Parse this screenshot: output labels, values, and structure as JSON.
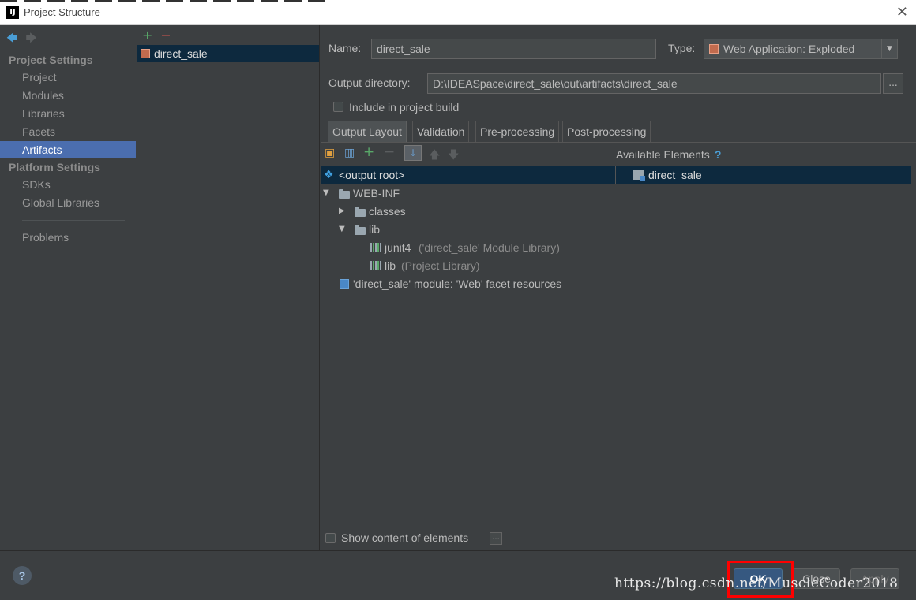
{
  "window": {
    "title": "Project Structure",
    "app_icon": "IJ",
    "close_glyph": "✕"
  },
  "nav": {
    "back_glyph": "🡄",
    "fwd_glyph": "🡆",
    "section_project": "Project Settings",
    "section_platform": "Platform Settings",
    "items": {
      "project": "Project",
      "modules": "Modules",
      "libraries": "Libraries",
      "facets": "Facets",
      "artifacts": "Artifacts",
      "sdks": "SDKs",
      "global_libraries": "Global Libraries",
      "problems": "Problems"
    },
    "selected": "Artifacts"
  },
  "artifacts": {
    "add_glyph": "+",
    "remove_glyph": "−",
    "items": [
      "direct_sale"
    ]
  },
  "details": {
    "name_label": "Name:",
    "name_value": "direct_sale",
    "type_label": "Type:",
    "type_value": "Web Application: Exploded",
    "output_dir_label": "Output directory:",
    "output_dir_value": "D:\\IDEASpace\\direct_sale\\out\\artifacts\\direct_sale",
    "browse_label": "...",
    "include_build_label": "Include in project build",
    "include_build_checked": false,
    "tabs": [
      "Output Layout",
      "Validation",
      "Pre-processing",
      "Post-processing"
    ],
    "active_tab": "Output Layout",
    "available_elements_label": "Available Elements",
    "available_help": "?",
    "tree": {
      "root": "<output root>",
      "webinf": "WEB-INF",
      "classes": "classes",
      "lib_folder": "lib",
      "junit_name": "junit4",
      "junit_suffix": "('direct_sale' Module Library)",
      "lib_name": "lib",
      "lib_suffix": "(Project Library)",
      "facet_resources": "'direct_sale' module: 'Web' facet resources"
    },
    "available": [
      "direct_sale"
    ],
    "show_content_label": "Show content of elements",
    "show_content_checked": false,
    "more_label": "..."
  },
  "footer": {
    "help": "?",
    "ok": "OK",
    "close": "Close",
    "apply": "Apply",
    "watermark": "https://blog.csdn.net/MuscleCoder2018"
  },
  "colors": {
    "background": "#3c3f41",
    "selection": "#0d293e",
    "nav_selected": "#4b6eaf",
    "ok_button": "#365880",
    "highlight_box": "#ff0000"
  }
}
